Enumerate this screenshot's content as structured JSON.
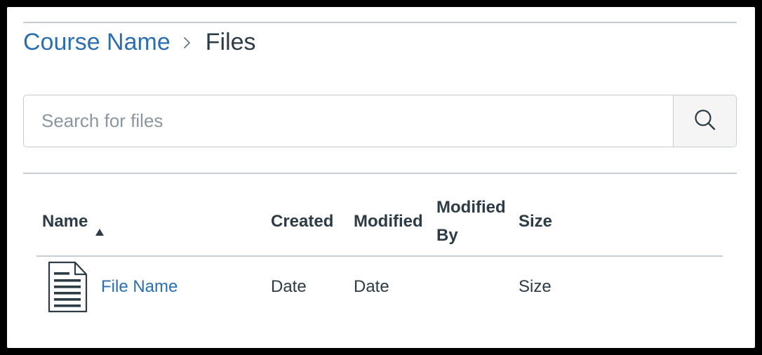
{
  "breadcrumb": {
    "course_name": "Course Name",
    "current": "Files"
  },
  "search": {
    "placeholder": "Search for files",
    "value": ""
  },
  "table": {
    "columns": {
      "name": "Name",
      "created": "Created",
      "modified": "Modified",
      "modified_by": "Modified By",
      "size": "Size"
    },
    "sort": {
      "column": "name",
      "direction": "ascending"
    },
    "rows": [
      {
        "icon": "document-icon",
        "name": "File Name",
        "created": "Date",
        "modified": "Date",
        "modified_by": "",
        "size": "Size"
      }
    ]
  },
  "colors": {
    "link": "#2b6fb1",
    "text": "#2d3b45",
    "border": "#c7cdd1",
    "search_button_bg": "#f5f5f5"
  }
}
